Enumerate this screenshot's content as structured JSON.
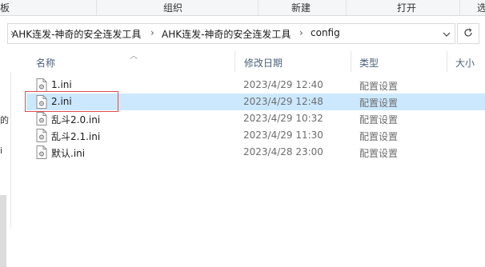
{
  "ribbon": {
    "groups": [
      "板",
      "组织",
      "新建",
      "打开",
      "选"
    ]
  },
  "address": {
    "crumbs": [
      "AHK连发-神奇的安全连发工具",
      "AHK连发-神奇的安全连发工具",
      "config"
    ],
    "separator": "›"
  },
  "nav_fragments": [
    "的",
    "i",
    "s"
  ],
  "columns": {
    "name": "名称",
    "date": "修改日期",
    "type": "类型",
    "size": "大小"
  },
  "files": [
    {
      "name": "1.ini",
      "date": "2023/4/29 12:40",
      "type": "配置设置",
      "selected": false
    },
    {
      "name": "2.ini",
      "date": "2023/4/29 12:48",
      "type": "配置设置",
      "selected": true
    },
    {
      "name": "乱斗2.0.ini",
      "date": "2023/4/29 10:32",
      "type": "配置设置",
      "selected": false
    },
    {
      "name": "乱斗2.1.ini",
      "date": "2023/4/29 11:30",
      "type": "配置设置",
      "selected": false
    },
    {
      "name": "默认.ini",
      "date": "2023/4/28 23:00",
      "type": "配置设置",
      "selected": false
    }
  ],
  "colors": {
    "selection": "#cce8ff",
    "highlight_border": "#e04b4b",
    "header_text": "#4c607a"
  }
}
